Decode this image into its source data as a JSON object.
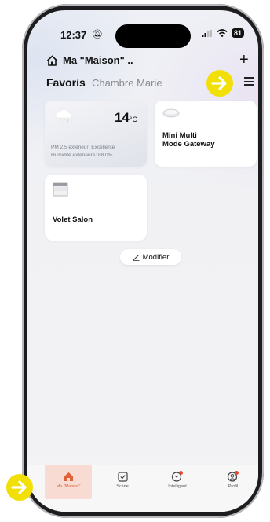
{
  "status": {
    "time": "12:37",
    "battery": "81"
  },
  "header": {
    "home_name": "Ma \"Maison\" ..",
    "add_symbol": "+"
  },
  "tabs": {
    "favorites": "Favoris",
    "room": "Chambre Marie"
  },
  "weather": {
    "temperature": "14",
    "unit": "°C",
    "pm25": "PM 2.5 extérieur: Excellente",
    "humidity": "Humidité extérieure: 68.0%"
  },
  "devices": [
    {
      "name_line1": "Mini Multi",
      "name_line2": "Mode Gateway"
    },
    {
      "name_line1": "Volet Salon"
    }
  ],
  "modifier_label": "Modifier",
  "bottom_nav": [
    {
      "label": "Ma \"Maison\"",
      "icon": "home-icon",
      "active": true
    },
    {
      "label": "Scène",
      "icon": "scene-icon",
      "active": false
    },
    {
      "label": "Intelligent",
      "icon": "smart-icon",
      "active": false
    },
    {
      "label": "Profil",
      "icon": "profile-icon",
      "active": false
    }
  ],
  "colors": {
    "accent": "#e0623a",
    "arrow": "#f2df05",
    "active_tab_bg": "#f8dcd4"
  }
}
